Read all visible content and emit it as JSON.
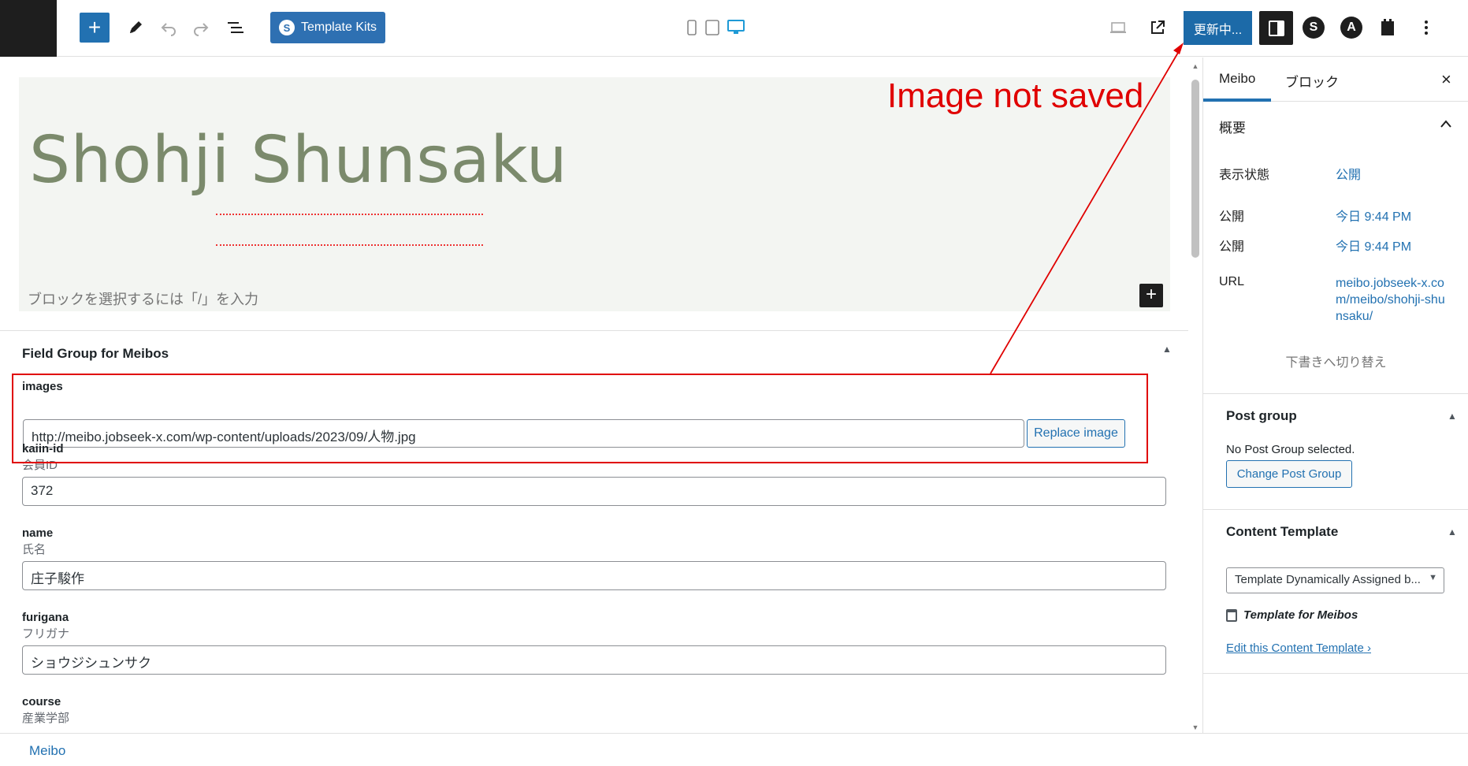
{
  "toolbar": {
    "add_symbol": "+",
    "template_kits_label": "Template Kits",
    "template_kits_logo": "S",
    "update_label": "更新中...",
    "strattic_icon_letter": "S",
    "astra_icon_letter": "A"
  },
  "cover": {
    "title": "Shohji Shunsaku",
    "block_placeholder": "ブロックを選択するには「/」を入力",
    "inline_add_symbol": "+"
  },
  "annotation": {
    "text": "Image not saved",
    "color": "#e00000"
  },
  "field_group": {
    "title": "Field Group for Meibos",
    "fields": [
      {
        "label": "images",
        "sub": "",
        "value": "http://meibo.jobseek-x.com/wp-content/uploads/2023/09/人物.jpg",
        "button": "Replace image"
      },
      {
        "label": "kaiin-id",
        "sub": "会員ID",
        "value": "372"
      },
      {
        "label": "name",
        "sub": "氏名",
        "value": "庄子駿作"
      },
      {
        "label": "furigana",
        "sub": "フリガナ",
        "value": "ショウジシュンサク"
      },
      {
        "label": "course",
        "sub": "産業学部"
      }
    ]
  },
  "footer": {
    "breadcrumb": "Meibo"
  },
  "sidebar": {
    "tab_post": "Meibo",
    "tab_block": "ブロック",
    "close_symbol": "×",
    "summary_title": "概要",
    "visibility_label": "表示状態",
    "visibility_value": "公開",
    "publish_label_1": "公開",
    "publish_value_1": "今日 9:44 PM",
    "publish_label_2": "公開",
    "publish_value_2": "今日 9:44 PM",
    "url_label": "URL",
    "url_value": "meibo.jobseek-x.com/meibo/shohji-shunsaku/",
    "switch_draft": "下書きへ切り替え",
    "post_group": {
      "title": "Post group",
      "status": "No Post Group selected.",
      "button": "Change Post Group"
    },
    "content_template": {
      "title": "Content Template",
      "selected": "Template Dynamically Assigned b...",
      "template_name": "Template for Meibos",
      "edit_link": "Edit this Content Template",
      "edit_link_arrow": "›"
    }
  },
  "colors": {
    "accent": "#2271b1",
    "cover_title": "#7b8a6c",
    "cover_bg": "#f3f5f2"
  }
}
